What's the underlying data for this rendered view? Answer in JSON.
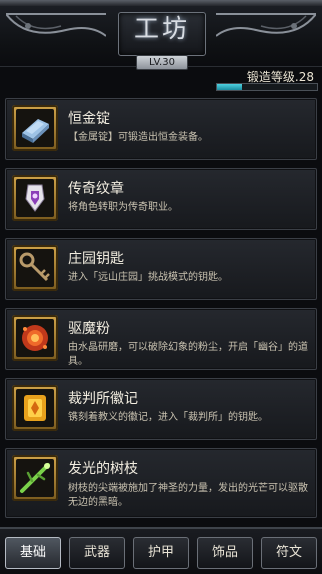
{
  "header": {
    "title": "工坊",
    "level_badge": "LV.30",
    "forge_level_label": "锻造等级.28",
    "forge_progress": 0.25
  },
  "items": [
    {
      "name": "恒金锭",
      "desc": "【金属锭】可锻造出恒金装备。",
      "icon": "ingot-icon"
    },
    {
      "name": "传奇纹章",
      "desc": "将角色转职为传奇职业。",
      "icon": "emblem-icon"
    },
    {
      "name": "庄园钥匙",
      "desc": "进入「远山庄园」挑战模式的钥匙。",
      "icon": "key-icon"
    },
    {
      "name": "驱魔粉",
      "desc": "由水晶研磨，可以破除幻象的粉尘，开启「幽谷」的道具。",
      "icon": "powder-icon"
    },
    {
      "name": "裁判所徽记",
      "desc": "镌刻着教义的徽记，进入「裁判所」的钥匙。",
      "icon": "insignia-icon"
    },
    {
      "name": "发光的树枝",
      "desc": "树枝的尖端被施加了神圣的力量，发出的光芒可以驱散无边的黑暗。",
      "icon": "branch-icon"
    }
  ],
  "tabs": [
    {
      "label": "基础",
      "active": true
    },
    {
      "label": "武器",
      "active": false
    },
    {
      "label": "护甲",
      "active": false
    },
    {
      "label": "饰品",
      "active": false
    },
    {
      "label": "符文",
      "active": false
    }
  ]
}
